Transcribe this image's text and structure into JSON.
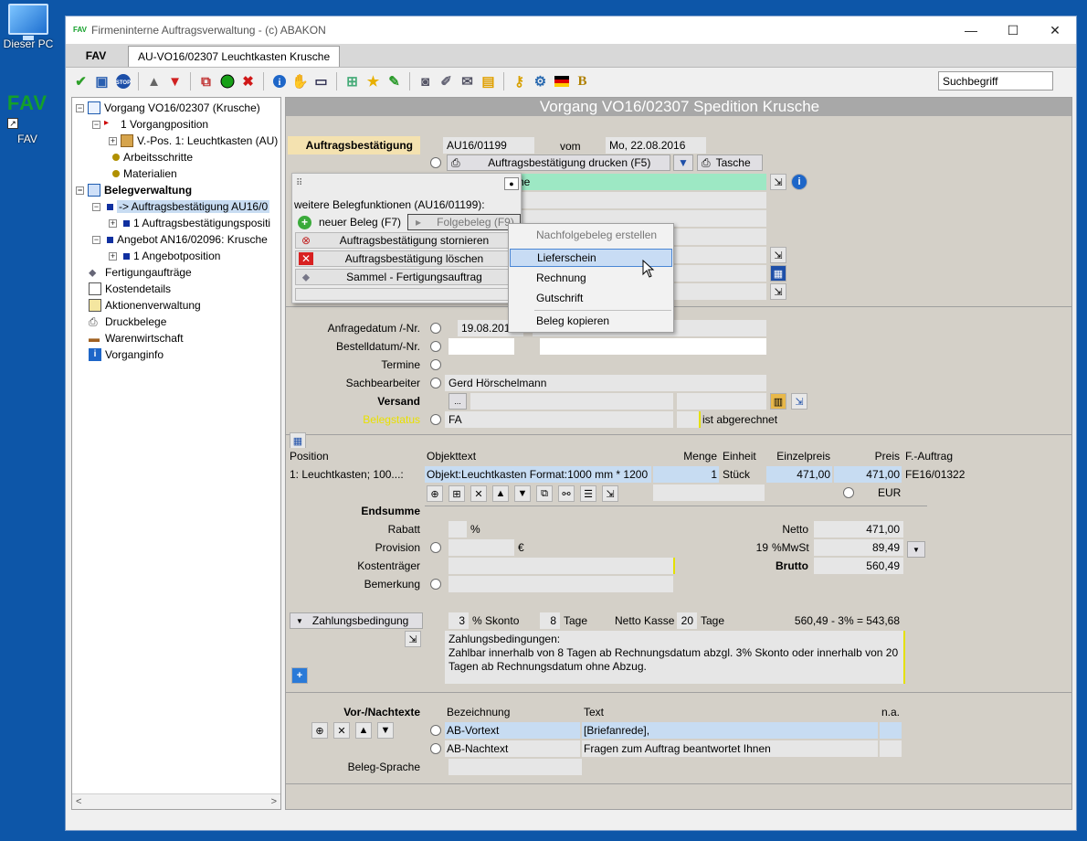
{
  "desktop": {
    "pc_label": "Dieser PC",
    "fav_logo": "FAV",
    "fav_label": "FAV"
  },
  "window": {
    "logo": "FAV",
    "title": "Firmeninterne Auftragsverwaltung - (c) ABAKON",
    "tab_fav": "FAV",
    "tab_doc": "AU-VO16/02307 Leuchtkasten Krusche",
    "search_value": "Suchbegriff",
    "minimize": "—",
    "maximize": "☐",
    "close": "✕"
  },
  "tree": {
    "items": [
      {
        "label": "Vorgang VO16/02307 (Krusche)"
      },
      {
        "label": "1 Vorgangposition"
      },
      {
        "label": "V.-Pos. 1: Leuchtkasten (AU)"
      },
      {
        "label": "Arbeitsschritte"
      },
      {
        "label": "Materialien"
      },
      {
        "label": "Belegverwaltung"
      },
      {
        "label": "-> Auftragsbestätigung AU16/0"
      },
      {
        "label": "1 Auftragsbestätigungspositi"
      },
      {
        "label": "Angebot AN16/02096: Krusche"
      },
      {
        "label": "1 Angebotposition"
      },
      {
        "label": "Fertigungaufträge"
      },
      {
        "label": "Kostendetails"
      },
      {
        "label": "Aktionenverwaltung"
      },
      {
        "label": "Druckbelege"
      },
      {
        "label": "Warenwirtschaft"
      },
      {
        "label": "Vorganginfo"
      }
    ]
  },
  "form": {
    "header": "Vorgang VO16/02307 Spedition Krusche",
    "ab_label": "Auftragsbestätigung",
    "ab_number": "AU16/01199",
    "vom_label": "vom",
    "date": "Mo, 22.08.2016",
    "print_button": "Auftragsbestätigung drucken (F5)",
    "tasche_button": "Tasche",
    "partial_name": "he",
    "anfrage_label": "Anfragedatum /-Nr.",
    "anfrage_date": "19.08.2016",
    "bestell_label": "Bestelldatum/-Nr.",
    "termine_label": "Termine",
    "sachbearbeiter_label": "Sachbearbeiter",
    "sachbearbeiter": "Gerd Hörschelmann",
    "versand_label": "Versand",
    "belegstatus_label": "Belegstatus",
    "belegstatus": "FA",
    "abgerechnet": "ist abgerechnet",
    "versand_btn": "..."
  },
  "positions": {
    "headers": [
      "Position",
      "Objekttext",
      "Menge",
      "Einheit",
      "Einzelpreis",
      "Preis",
      "F.-Auftrag"
    ],
    "row": {
      "position": "1: Leuchtkasten; 100...:",
      "objekttext": "Objekt:Leuchtkasten Format:1000 mm * 1200",
      "menge": "1",
      "einheit": "Stück",
      "einzelpreis": "471,00",
      "preis": "471,00",
      "fauftrag": "FE16/01322"
    },
    "currency": "EUR"
  },
  "totals": {
    "endsumme_label": "Endsumme",
    "rabatt_label": "Rabatt",
    "rabatt_unit": "%",
    "provision_label": "Provision",
    "provision_unit": "€",
    "kostentraeger_label": "Kostenträger",
    "bemerkung_label": "Bemerkung",
    "netto_label": "Netto",
    "netto": "471,00",
    "mwst_rate": "19",
    "mwst_label": "%MwSt",
    "mwst": "89,49",
    "brutto_label": "Brutto",
    "brutto": "560,49"
  },
  "payment": {
    "button": "Zahlungsbedingung",
    "skonto_val": "3",
    "skonto_label": "% Skonto",
    "tage_val": "8",
    "tage_label": "Tage",
    "netto_kasse_label": "Netto Kasse",
    "netto_kasse_val": "20",
    "netto_kasse_unit": "Tage",
    "calc": "560,49 - 3% = 543,68",
    "text_line1": "Zahlungsbedingungen:",
    "text_line2": "Zahlbar innerhalb von 8 Tagen ab Rechnungsdatum abzgl. 3% Skonto oder innerhalb von 20",
    "text_line3": "Tagen ab Rechnungsdatum ohne Abzug."
  },
  "texts": {
    "section_label": "Vor-/Nachtexte",
    "headers": [
      "Bezeichnung",
      "Text",
      "n.a."
    ],
    "rows": [
      {
        "bez": "AB-Vortext",
        "text": "[Briefanrede],"
      },
      {
        "bez": "AB-Nachtext",
        "text": "Fragen zum Auftrag beantwortet Ihnen"
      }
    ],
    "sprache_label": "Beleg-Sprache"
  },
  "popup": {
    "title": "weitere Belegfunktionen (AU16/01199):",
    "neuer_beleg": "neuer Beleg (F7)",
    "folgebeleg": "Folgebeleg (F9)",
    "stornieren": "Auftragsbestätigung stornieren",
    "loeschen": "Auftragsbestätigung löschen",
    "sammel": "Sammel - Fertigungsauftrag"
  },
  "context_menu": {
    "items": [
      {
        "label": "Nachfolgebeleg erstellen"
      },
      {
        "label": "Lieferschein"
      },
      {
        "label": "Rechnung"
      },
      {
        "label": "Gutschrift"
      },
      {
        "label": "Beleg kopieren"
      }
    ]
  },
  "colors": {
    "desktop": "#0d56a8",
    "form_bg": "#d4d0c8",
    "selected_row": "#c7dcf2",
    "accent_green": "#14a02a",
    "label_highlight": "#f4e2b0"
  }
}
